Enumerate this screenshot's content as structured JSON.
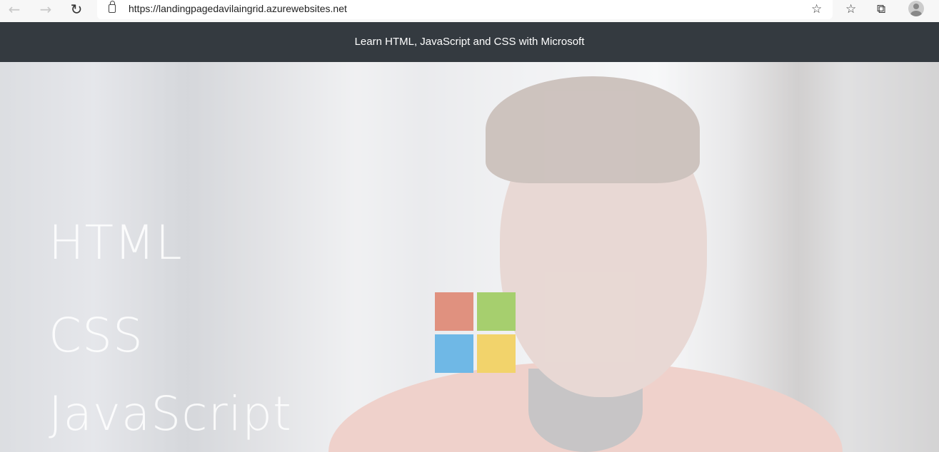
{
  "browser": {
    "url": "https://landingpagedavilaingrid.azurewebsites.net"
  },
  "header": {
    "title": "Learn HTML, JavaScript and CSS with Microsoft"
  },
  "hero": {
    "words": [
      "HTML",
      "CSS",
      "JavaScript"
    ],
    "logo_colors": {
      "red": "#e0917f",
      "green": "#a6cf6e",
      "blue": "#6fb8e6",
      "yellow": "#f2d36b"
    }
  }
}
